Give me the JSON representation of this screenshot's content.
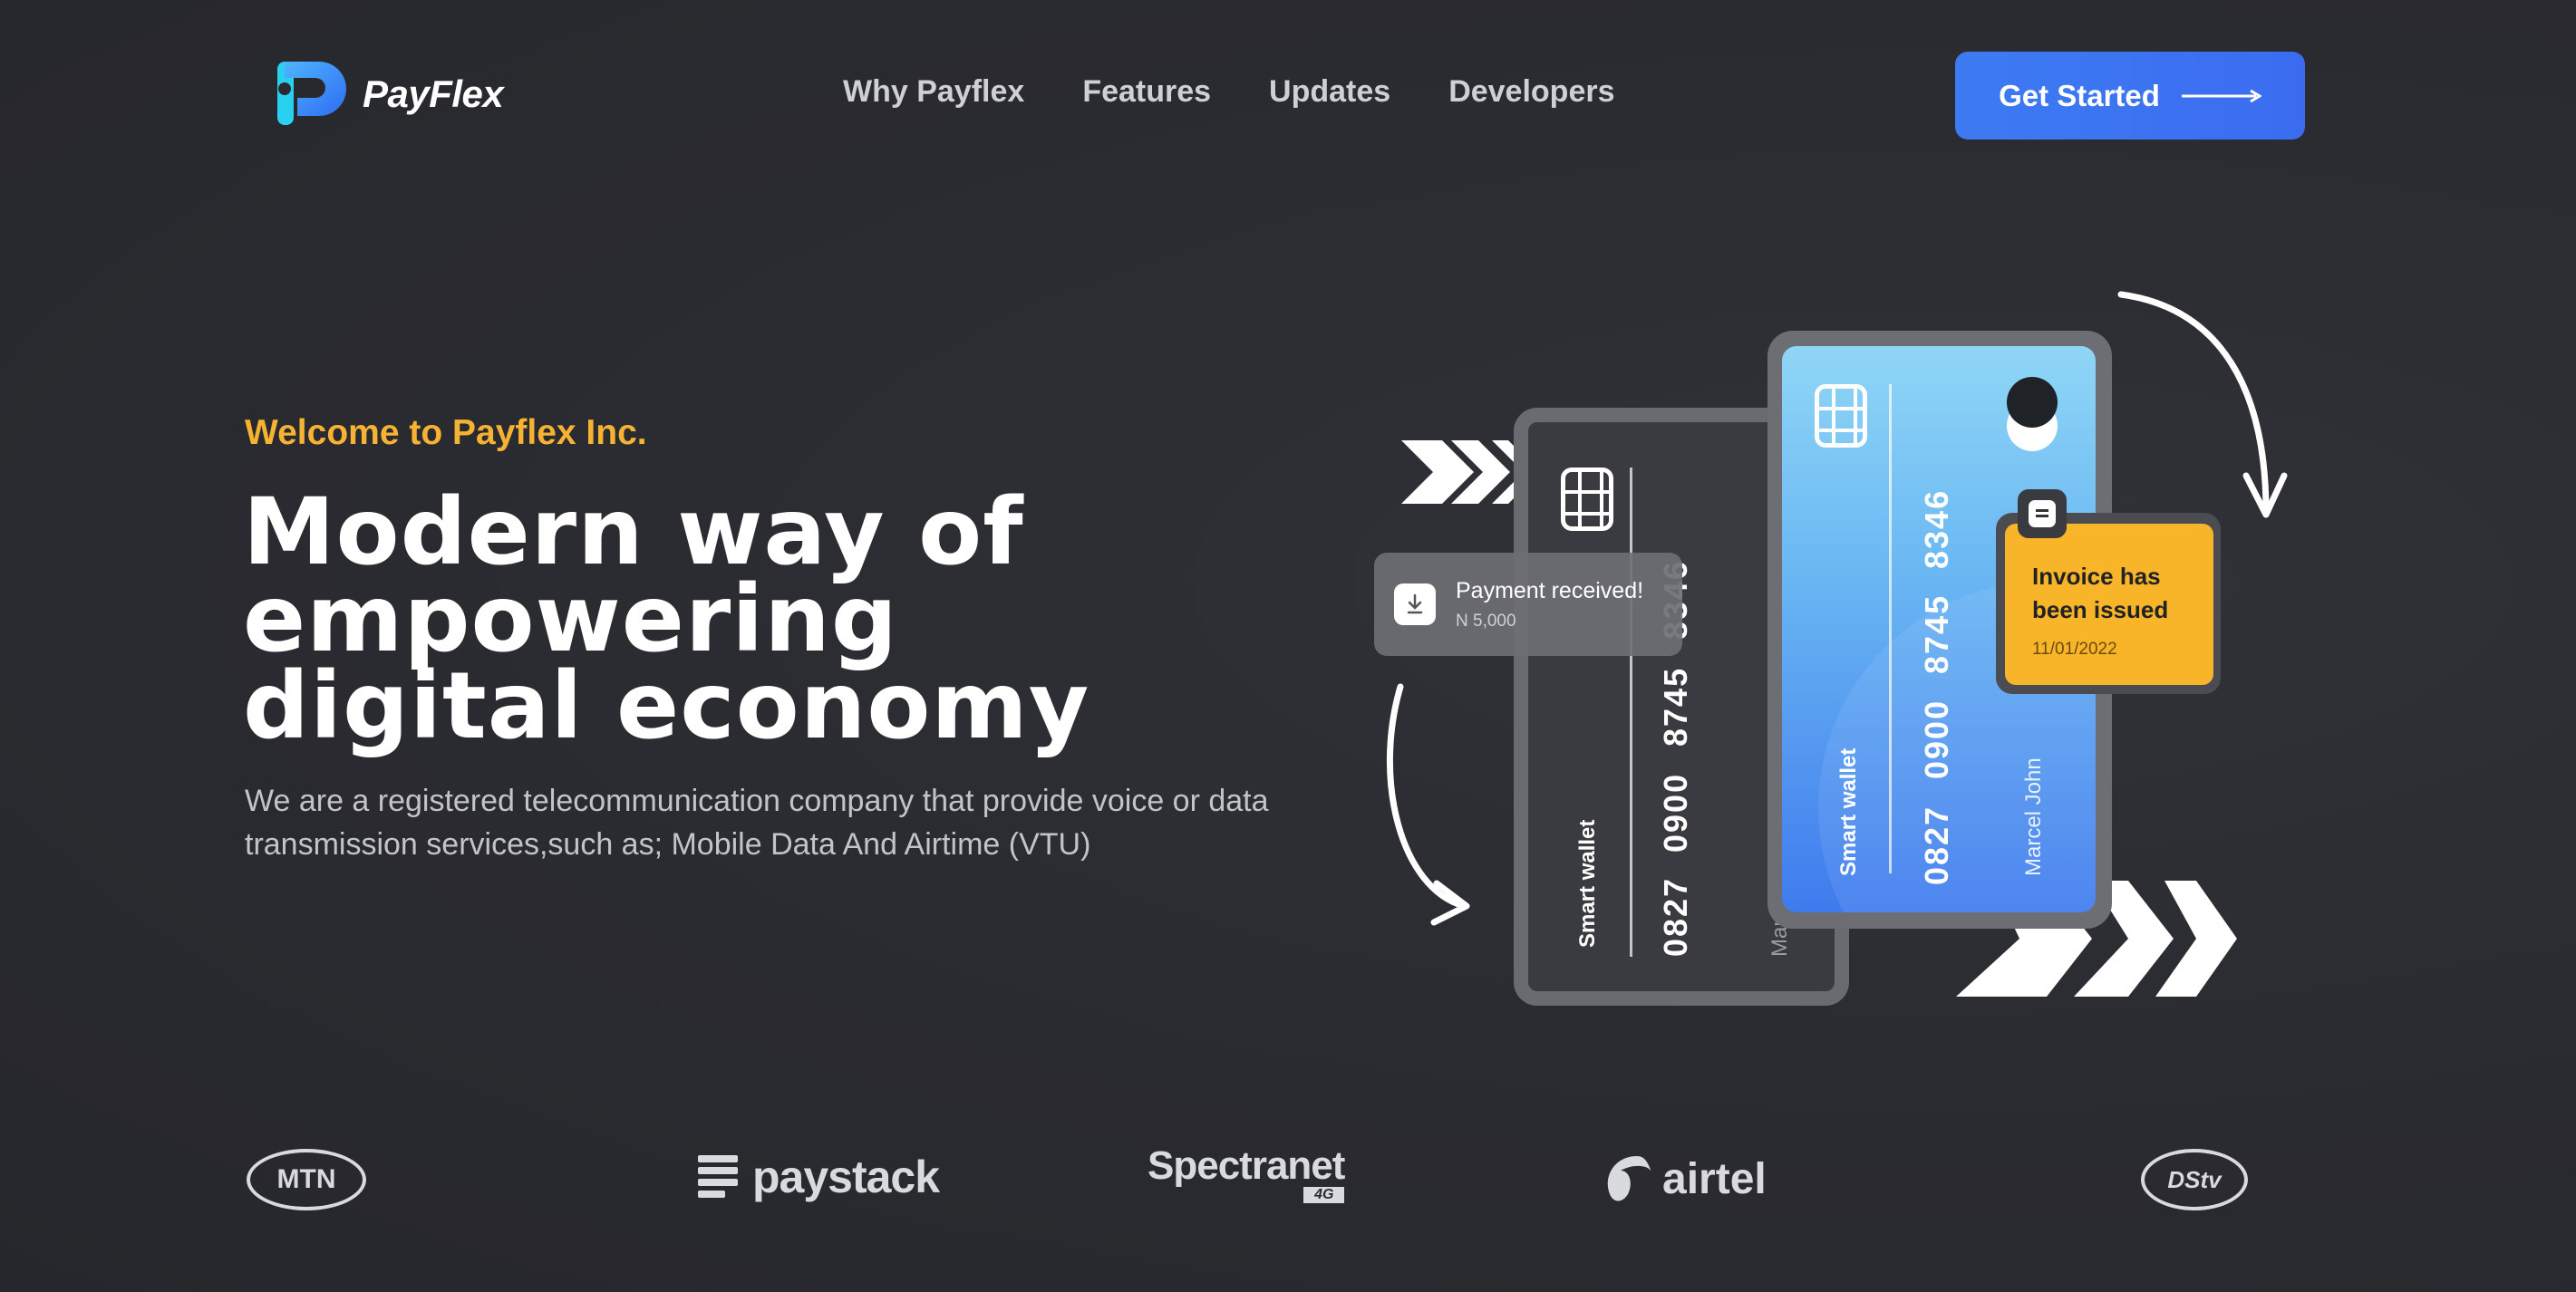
{
  "brand": {
    "name": "PayFlex"
  },
  "nav": {
    "items": [
      {
        "label": "Why Payflex"
      },
      {
        "label": "Features"
      },
      {
        "label": "Updates"
      },
      {
        "label": "Developers"
      }
    ],
    "cta_label": "Get Started"
  },
  "hero": {
    "eyebrow": "Welcome to Payflex Inc.",
    "headline": [
      "Modern way of",
      "empowering",
      "digital economy"
    ],
    "subtext": "We are a registered telecommunication company that provide voice or data transmission services,such as; Mobile Data And Airtime (VTU)"
  },
  "cards": {
    "dark": {
      "label": "Smart wallet",
      "number": [
        "0827",
        "0900",
        "8745",
        "8346"
      ],
      "holder": "Marcel John"
    },
    "blue": {
      "label": "Smart wallet",
      "number": [
        "0827",
        "0900",
        "8745",
        "8346"
      ],
      "holder": "Marcel John"
    }
  },
  "notifications": {
    "payment": {
      "title": "Payment received!",
      "amount": "N 5,000"
    },
    "invoice": {
      "title_line1": "Invoice has",
      "title_line2": "been issued",
      "date": "11/01/2022"
    }
  },
  "partners": [
    {
      "name": "MTN"
    },
    {
      "name": "paystack"
    },
    {
      "name": "Spectranet",
      "tag": "4G"
    },
    {
      "name": "airtel"
    },
    {
      "name": "DStv"
    }
  ],
  "colors": {
    "accent": "#f5b233",
    "cta": "#3d7bf2",
    "background": "#2a2b30",
    "invoice": "#f8b52a"
  }
}
